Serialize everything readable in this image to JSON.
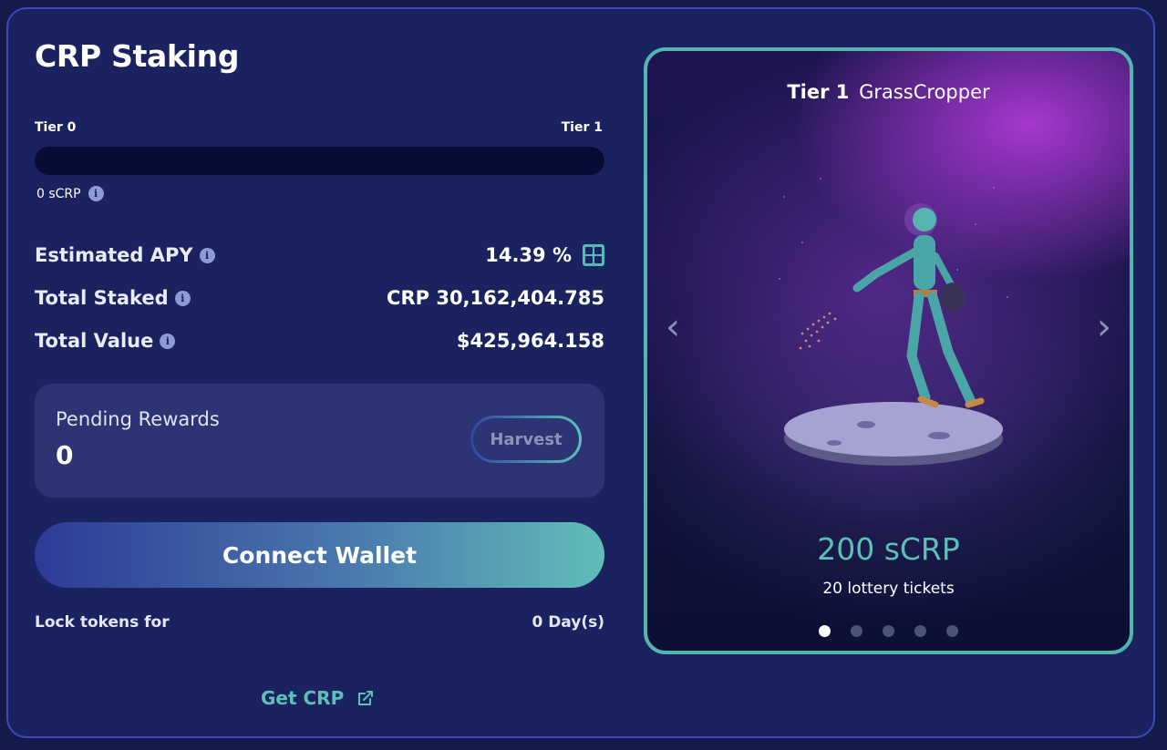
{
  "title": "CRP Staking",
  "tier_progress": {
    "left_label": "Tier 0",
    "right_label": "Tier 1",
    "progress_fraction": 0,
    "balance_text": "0 sCRP"
  },
  "stats": {
    "apy_label": "Estimated APY",
    "apy_value": "14.39 %",
    "staked_label": "Total Staked",
    "staked_value": "CRP 30,162,404.785",
    "value_label": "Total Value",
    "value_value": "$425,964.158"
  },
  "rewards": {
    "label": "Pending Rewards",
    "value": "0",
    "harvest_label": "Harvest"
  },
  "connect_label": "Connect Wallet",
  "lock": {
    "label": "Lock tokens for",
    "value": "0 Day(s)"
  },
  "get_crp_label": "Get CRP",
  "card": {
    "tier_strong": "Tier 1",
    "tier_name": "GrassCropper",
    "amount": "200 sCRP",
    "subtitle": "20 lottery tickets",
    "slide_count": 5,
    "active_slide": 1
  },
  "icons": {
    "info": "info-icon",
    "calculator": "calculator-icon",
    "external": "external-link-icon",
    "prev": "chevron-left-icon",
    "next": "chevron-right-icon"
  },
  "colors": {
    "background": "#1b2260",
    "accent_teal": "#5cc0b8",
    "card_border": "#55b3b0",
    "progress_track": "#070c36"
  }
}
